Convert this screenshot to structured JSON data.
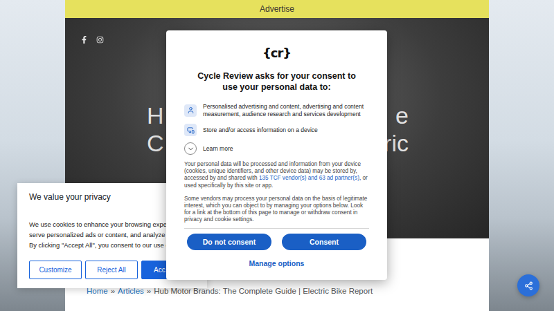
{
  "ad_bar": {
    "label": "Advertise"
  },
  "hero": {
    "title_fragments": [
      {
        "left": "H",
        "right": "e"
      },
      {
        "left": "C",
        "right": "ric"
      }
    ]
  },
  "breadcrumb": {
    "separator": "»",
    "items": [
      {
        "label": "Home",
        "link": true
      },
      {
        "label": "Articles",
        "link": true
      },
      {
        "label": "Hub Motor Brands: The Complete Guide | Electric Bike Report",
        "link": false
      }
    ]
  },
  "cookie_banner": {
    "title": "We value your privacy",
    "lines": [
      "We use cookies to enhance your browsing experi",
      "serve personalized ads or content, and analyze ou",
      "By clicking \"Accept All\", you consent to our use o"
    ],
    "buttons": [
      {
        "label": "Customize",
        "kind": "outline"
      },
      {
        "label": "Reject All",
        "kind": "outline"
      },
      {
        "label": "Acc",
        "kind": "primary"
      }
    ]
  },
  "consent_modal": {
    "logo": "{cr}",
    "title": "Cycle Review asks for your consent to use your personal data to:",
    "purposes": [
      {
        "text": "Personalised advertising and content, advertising and content measurement, audience research and services development",
        "kind": "ads"
      },
      {
        "text": "Store and/or access information on a device",
        "kind": "device"
      },
      {
        "text": "Learn more",
        "kind": "learn"
      }
    ],
    "paragraph_1": {
      "before": "Your personal data will be processed and information from your device (cookies, unique identifiers, and other device data) may be stored by, accessed by and shared with ",
      "link": "135 TCF vendor(s) and 63 ad partner(s)",
      "after": ", or used specifically by this site or app."
    },
    "paragraph_2": "Some vendors may process your personal data on the basis of legitimate interest, which you can object to by managing your options below. Look for a link at the bottom of this page to manage or withdraw consent in privacy and cookie settings.",
    "buttons": [
      "Do not consent",
      "Consent"
    ],
    "manage_link": "Manage options"
  }
}
